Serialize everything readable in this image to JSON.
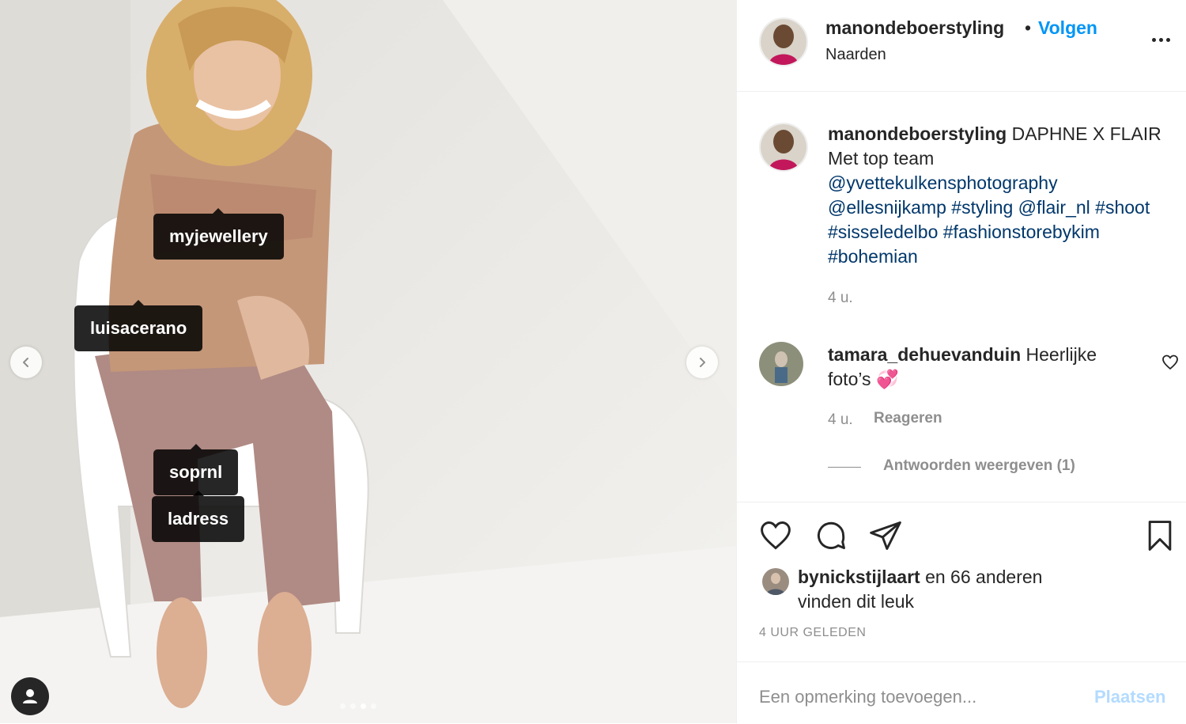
{
  "photo": {
    "tags": [
      "myjewellery",
      "luisacerano",
      "soprnl",
      "ladress"
    ],
    "carousel": {
      "count": 4,
      "active": 2
    }
  },
  "header": {
    "username": "manondeboerstyling",
    "separator": "•",
    "follow_label": "Volgen",
    "location": "Naarden"
  },
  "caption": {
    "username": "manondeboerstyling",
    "text_line1": "DAPHNE X FLAIR",
    "text_line2": "Met top team",
    "mention_1": "@yvettekulkensphotography",
    "mention_2": "@ellesnijkamp",
    "hashtag_1": "#styling",
    "mention_3": "@flair_nl",
    "hashtag_2": "#shoot",
    "hashtag_3": "#sisseledelbo",
    "hashtag_4": "#fashionstorebykim",
    "hashtag_5": "#bohemian",
    "time": "4 u."
  },
  "comment": {
    "username": "tamara_dehuevanduin",
    "text": "Heerlijke foto’s",
    "emoji": "💞",
    "time": "4 u.",
    "reply_label": "Reageren",
    "view_replies": "Antwoorden weergeven (1)"
  },
  "likes": {
    "user": "bynickstijlaart",
    "and_others": "en 66 anderen",
    "suffix": "vinden dit leuk"
  },
  "timestamp": "4 UUR GELEDEN",
  "add_comment": {
    "placeholder": "Een opmerking toevoegen...",
    "post_label": "Plaatsen"
  },
  "colors": {
    "accent": "#0095f6",
    "link": "#00376b",
    "muted": "#8e8e8e",
    "post_disabled": "#b3dbff"
  },
  "icons": [
    "chevron-left-icon",
    "chevron-right-icon",
    "user-icon",
    "more-icon",
    "heart-icon",
    "comment-icon",
    "share-icon",
    "bookmark-icon"
  ]
}
